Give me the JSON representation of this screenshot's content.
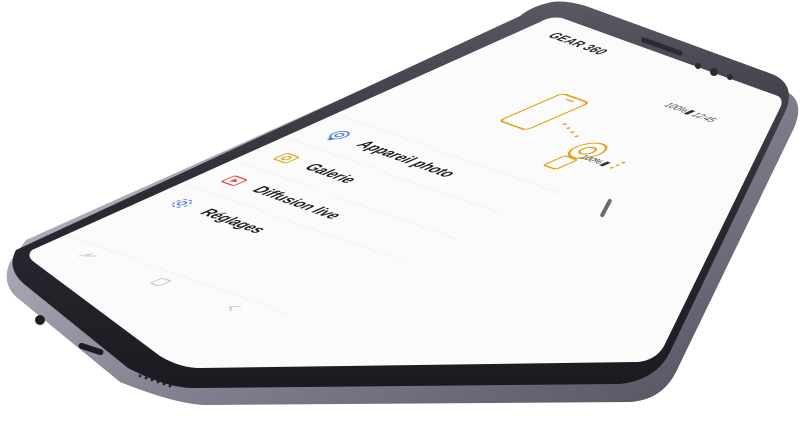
{
  "app": {
    "title": "GEAR 360"
  },
  "status_bar": {
    "battery": "100%",
    "time": "12:45"
  },
  "device": {
    "battery": "100%"
  },
  "menu": {
    "items": [
      {
        "label": "Appareil photo",
        "icon": "camera-360-icon"
      },
      {
        "label": "Galerie",
        "icon": "gallery-icon"
      },
      {
        "label": "Diffusion live",
        "icon": "live-broadcast-icon"
      },
      {
        "label": "Réglages",
        "icon": "settings-gear-icon"
      }
    ]
  },
  "navbar": {
    "buttons": [
      "recent-apps",
      "home",
      "back"
    ]
  },
  "colors": {
    "accent": "#e6a116",
    "live_icon": "#e0483b",
    "settings_icon": "#4a7fd6",
    "camera_icon": "#4a7fd6",
    "phone_frame": "#3c3b47",
    "screen_bg": "#fbfbfb"
  }
}
